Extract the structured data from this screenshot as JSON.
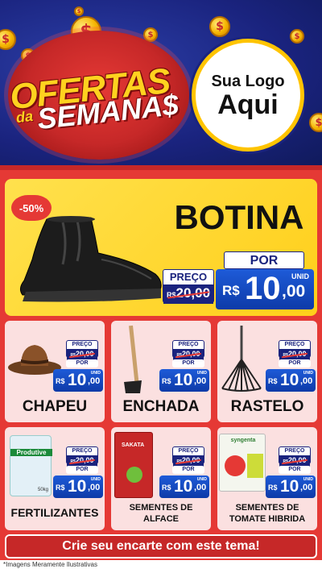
{
  "header": {
    "title_line1": "OFERTAS",
    "title_da": "da",
    "title_line2": "SEMANA$",
    "logo_line1": "Sua Logo",
    "logo_line2": "Aqui",
    "coin_symbol": "$"
  },
  "featured": {
    "discount": "-50%",
    "name": "BOTINA",
    "preco_label": "PREÇO",
    "old_currency": "R$",
    "old_price": "20,00",
    "por_label": "POR",
    "unid_label": "UNID",
    "currency": "R$",
    "price_int": "10",
    "price_cents": ",00"
  },
  "products": [
    {
      "name": "CHAPEU",
      "preco_label": "PREÇO",
      "old_currency": "R$",
      "old_price": "20,00",
      "por_label": "POR",
      "unid_label": "UNID",
      "currency": "R$",
      "price_int": "10",
      "price_cents": ",00"
    },
    {
      "name": "ENCHADA",
      "preco_label": "PREÇO",
      "old_currency": "R$",
      "old_price": "20,00",
      "por_label": "POR",
      "unid_label": "UNID",
      "currency": "R$",
      "price_int": "10",
      "price_cents": ",00"
    },
    {
      "name": "RASTELO",
      "preco_label": "PREÇO",
      "old_currency": "R$",
      "old_price": "20,00",
      "por_label": "POR",
      "unid_label": "UNID",
      "currency": "R$",
      "price_int": "10",
      "price_cents": ",00"
    },
    {
      "name": "FERTILIZANTES",
      "preco_label": "PREÇO",
      "old_currency": "R$",
      "old_price": "20,00",
      "por_label": "POR",
      "unid_label": "UNID",
      "currency": "R$",
      "price_int": "10",
      "price_cents": ",00",
      "package_brand": "Produtive",
      "package_weight": "50kg"
    },
    {
      "name_line1": "SEMENTES DE",
      "name_line2": "ALFACE",
      "preco_label": "PREÇO",
      "old_currency": "R$",
      "old_price": "20,00",
      "por_label": "POR",
      "unid_label": "UNID",
      "currency": "R$",
      "price_int": "10",
      "price_cents": ",00",
      "package_brand": "SAKATA"
    },
    {
      "name_line1": "SEMENTES DE",
      "name_line2": "TOMATE HIBRIDA",
      "preco_label": "PREÇO",
      "old_currency": "R$",
      "old_price": "20,00",
      "por_label": "POR",
      "unid_label": "UNID",
      "currency": "R$",
      "price_int": "10",
      "price_cents": ",00",
      "package_brand": "syngenta"
    }
  ],
  "cta": "Crie seu encarte com este tema!",
  "disclaimer": "*Imagens Meramente Ilustrativas",
  "colors": {
    "header_blue": "#1a237e",
    "red": "#e53935",
    "yellow": "#ffd21f",
    "price_blue": "#1e5bd8",
    "card_pink": "#fbe0e0"
  }
}
